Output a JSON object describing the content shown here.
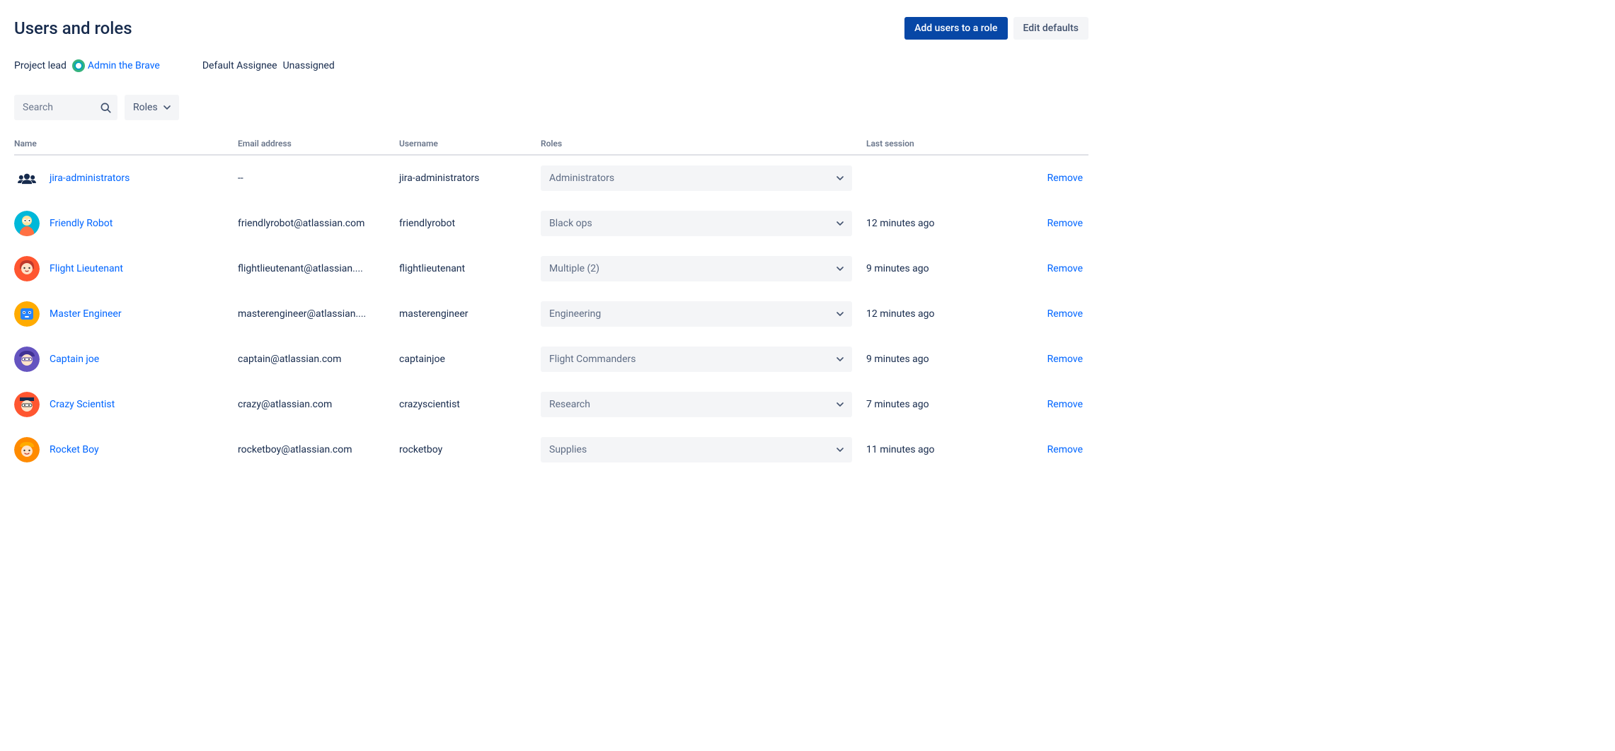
{
  "header": {
    "title": "Users and roles",
    "add_users_label": "Add users to a role",
    "edit_defaults_label": "Edit defaults"
  },
  "meta": {
    "project_lead_label": "Project lead",
    "project_lead_name": "Admin the Brave",
    "default_assignee_label": "Default Assignee",
    "default_assignee_value": "Unassigned"
  },
  "filters": {
    "search_placeholder": "Search",
    "roles_label": "Roles"
  },
  "columns": {
    "name": "Name",
    "email": "Email address",
    "username": "Username",
    "roles": "Roles",
    "last_session": "Last session"
  },
  "actions": {
    "remove": "Remove"
  },
  "users": [
    {
      "name": "jira-administrators",
      "email": "--",
      "username": "jira-administrators",
      "role": "Administrators",
      "last_session": "",
      "avatar_type": "group"
    },
    {
      "name": "Friendly Robot",
      "email": "friendlyrobot@atlassian.com",
      "username": "friendlyrobot",
      "role": "Black ops",
      "last_session": "12 minutes ago",
      "avatar_type": "teal"
    },
    {
      "name": "Flight Lieutenant",
      "email": "flightlieutenant@atlassian....",
      "username": "flightlieutenant",
      "role": "Multiple (2)",
      "last_session": "9 minutes ago",
      "avatar_type": "red"
    },
    {
      "name": "Master Engineer",
      "email": "masterengineer@atlassian....",
      "username": "masterengineer",
      "role": "Engineering",
      "last_session": "12 minutes ago",
      "avatar_type": "yellow"
    },
    {
      "name": "Captain joe",
      "email": "captain@atlassian.com",
      "username": "captainjoe",
      "role": "Flight Commanders",
      "last_session": "9 minutes ago",
      "avatar_type": "purple"
    },
    {
      "name": "Crazy Scientist",
      "email": "crazy@atlassian.com",
      "username": "crazyscientist",
      "role": "Research",
      "last_session": "7 minutes ago",
      "avatar_type": "orange"
    },
    {
      "name": "Rocket Boy",
      "email": "rocketboy@atlassian.com",
      "username": "rocketboy",
      "role": "Supplies",
      "last_session": "11 minutes ago",
      "avatar_type": "orange2"
    }
  ]
}
